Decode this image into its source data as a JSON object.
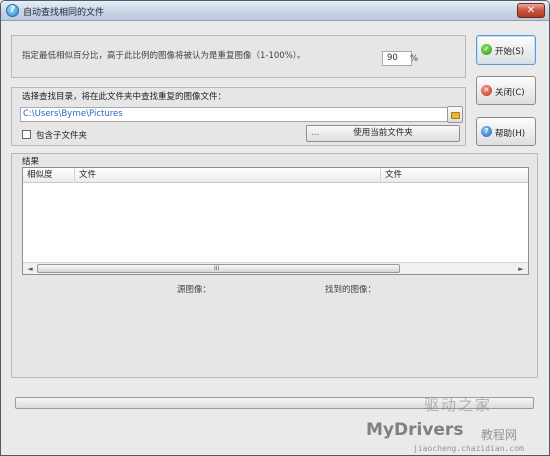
{
  "window": {
    "title": "自动查找相同的文件",
    "close_glyph": "✕"
  },
  "threshold": {
    "description": "指定最低相似百分比，高于此比例的图像将被认为是重复图像（1-100%）。",
    "value": "90",
    "unit": "%"
  },
  "directory": {
    "label": "选择查找目录，将在此文件夹中查找重复的图像文件：",
    "path": "C:\\Users\\Byrne\\Pictures",
    "include_subfolders_label": "包含子文件夹",
    "include_subfolders_checked": false,
    "use_current_label": "使用当前文件夹",
    "use_current_prefix": "..."
  },
  "results": {
    "label": "结果",
    "columns": [
      "相似度",
      "文件",
      "文件"
    ],
    "rows": [],
    "scroll_left": "◄",
    "scroll_right": "►",
    "scroll_grip": "III",
    "source_image_label": "源图像：",
    "found_image_label": "找到的图像："
  },
  "buttons": {
    "start": "开始(S)",
    "close": "关闭(C)",
    "help": "帮助(H)"
  },
  "progress": {
    "value": 0
  },
  "watermark": {
    "line1": "驱动之家",
    "line2": "MyDrivers",
    "line3": "教程网",
    "line4": "jiaocheng.chazidian.com"
  },
  "colors": {
    "path_text": "#2b64c8",
    "start_icon": "#2d9a1b",
    "close_icon": "#c42c18",
    "help_icon": "#1f64b8"
  }
}
